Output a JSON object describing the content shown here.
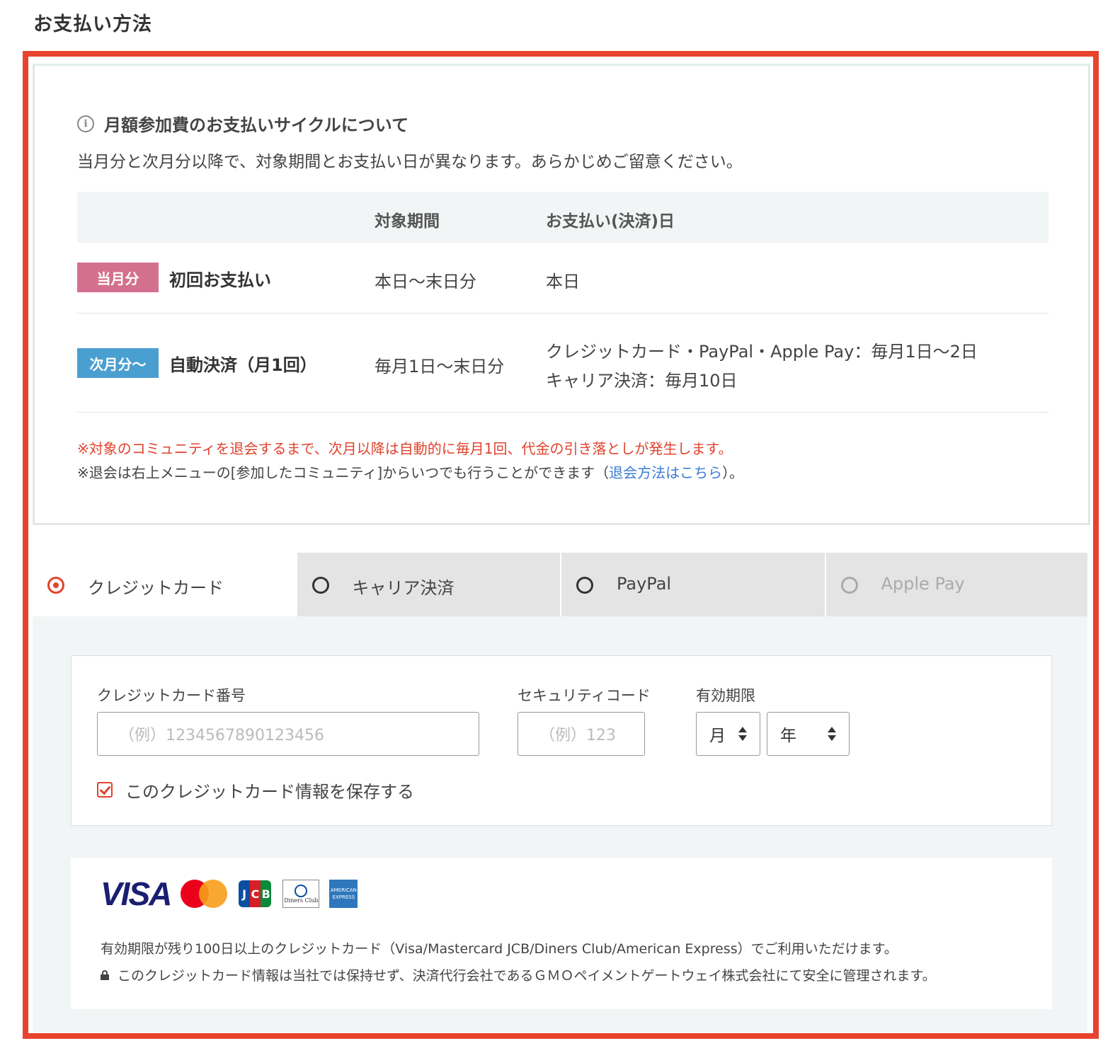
{
  "page": {
    "section_title": "お支払い方法"
  },
  "info": {
    "heading": "月額参加費のお支払いサイクルについて",
    "description": "当月分と次月分以降で、対象期間とお支払い日が異なります。あらかじめご留意ください。",
    "columns": [
      "対象期間",
      "お支払い(決済)日"
    ],
    "rows": [
      {
        "badge": "当月分",
        "title": "初回お支払い",
        "period": "本日〜末日分",
        "date_lines": [
          "本日"
        ]
      },
      {
        "badge": "次月分〜",
        "title": "自動決済（月1回）",
        "period": "毎月1日〜末日分",
        "date_lines": [
          "クレジットカード・PayPal・Apple Pay：毎月1日〜2日",
          "キャリア決済：毎月10日"
        ]
      }
    ],
    "note_red": "※対象のコミュニティを退会するまで、次月以降は自動的に毎月1回、代金の引き落としが発生します。",
    "note_prefix": "※退会は右上メニューの[参加したコミュニティ]からいつでも行うことができます（",
    "note_link": "退会方法はこちら",
    "note_suffix": "）。"
  },
  "tabs": [
    {
      "label": "クレジットカード",
      "state": "selected"
    },
    {
      "label": "キャリア決済",
      "state": "unselected"
    },
    {
      "label": "PayPal",
      "state": "unselected"
    },
    {
      "label": "Apple Pay",
      "state": "disabled"
    }
  ],
  "card_form": {
    "number_label": "クレジットカード番号",
    "number_placeholder": "（例）1234567890123456",
    "cvc_label": "セキュリティコード",
    "cvc_placeholder": "（例）123",
    "expiry_label": "有効期限",
    "month_value": "月",
    "year_value": "年",
    "save_label": "このクレジットカード情報を保存する",
    "save_checked": true
  },
  "brands": {
    "visa": "VISA",
    "jcb": "JCB",
    "diners": "Diners Club INTERNATIONAL",
    "amex": "AMERICAN EXPRESS",
    "notice": "有効期限が残り100日以上のクレジットカード（Visa/Mastercard JCB/Diners Club/American Express）でご利用いただけます。",
    "security": "このクレジットカード情報は当社では保持せず、決済代行会社であるＧＭＯペイメントゲートウェイ株式会社にて安全に管理されます。"
  },
  "colors": {
    "highlight": "#e8432e",
    "accent": "#e0432e",
    "badge_current": "#d4708f",
    "badge_next": "#4a9fd1",
    "link": "#3a7bd5"
  }
}
